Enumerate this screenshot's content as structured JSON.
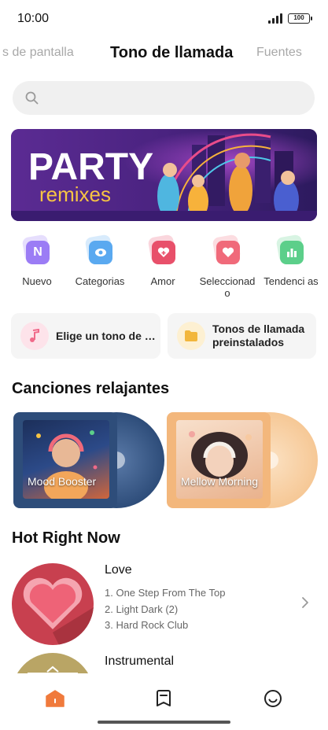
{
  "status_bar": {
    "time": "10:00",
    "battery": "100"
  },
  "top_tabs": [
    {
      "label": "s de pantalla"
    },
    {
      "label": "Tono de llamada"
    },
    {
      "label": "Fuentes"
    }
  ],
  "search": {
    "placeholder": ""
  },
  "banner": {
    "title_line1": "PARTY",
    "title_line2": "remixes"
  },
  "categories": [
    {
      "label": "Nuevo",
      "icon": "new-icon",
      "color": "#9b7cf5"
    },
    {
      "label": "Categorias",
      "icon": "eye-icon",
      "color": "#5aa9f0"
    },
    {
      "label": "Amor",
      "icon": "heart-plus-icon",
      "color": "#e8506a"
    },
    {
      "label": "Seleccionad o",
      "icon": "heart-icon",
      "color": "#f06a7a"
    },
    {
      "label": "Tendenci as",
      "icon": "bar-chart-icon",
      "color": "#5ccf8a"
    }
  ],
  "quick_actions": {
    "choose": {
      "label": "Elige un tono de lla...",
      "icon": "music-note-icon",
      "color": "#f06a8a"
    },
    "preinstalled": {
      "label": "Tonos de llamada preinstalados",
      "icon": "folder-icon",
      "color": "#f2b63c"
    }
  },
  "relaxing": {
    "title": "Canciones relajantes",
    "albums": [
      {
        "title": "Mood Booster",
        "sleeve_color": "#2e4d7a",
        "disc_color": "#3b5d8c"
      },
      {
        "title": "Mellow Morning",
        "sleeve_color": "#f3b77c",
        "disc_color": "#f6c896"
      }
    ]
  },
  "hot": {
    "title": "Hot Right Now",
    "items": [
      {
        "title": "Love",
        "tracks": [
          "1. One Step From The Top",
          "2. Light Dark (2)",
          "3. Hard Rock Club"
        ]
      },
      {
        "title": "Instrumental",
        "tracks": []
      }
    ]
  },
  "bottom_nav": [
    {
      "name": "home",
      "icon": "home-icon",
      "active": true
    },
    {
      "name": "saved",
      "icon": "bookmark-icon",
      "active": false
    },
    {
      "name": "profile",
      "icon": "smiley-icon",
      "active": false
    }
  ],
  "accent_color": "#f07a3c"
}
